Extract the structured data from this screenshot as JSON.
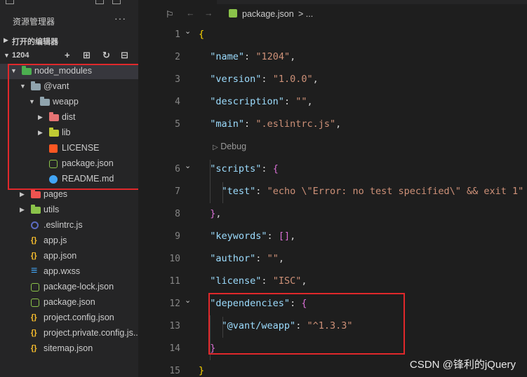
{
  "explorer": {
    "title": "资源管理器",
    "more": "···",
    "open_editors": "打开的编辑器",
    "project": "1204",
    "actions": [
      "+",
      "⊞",
      "↻",
      "⊟"
    ]
  },
  "tree": [
    {
      "name": "node_modules",
      "depth": 0,
      "chevron": "▼",
      "icon": "folder-icon",
      "color": "#4caf50"
    },
    {
      "name": "@vant",
      "depth": 1,
      "chevron": "▼",
      "icon": "folder-open-icon",
      "color": "#90a4ae"
    },
    {
      "name": "weapp",
      "depth": 2,
      "chevron": "▼",
      "icon": "folder-open-icon",
      "color": "#90a4ae"
    },
    {
      "name": "dist",
      "depth": 3,
      "chevron": "▶",
      "icon": "folder-icon",
      "color": "#e57373"
    },
    {
      "name": "lib",
      "depth": 3,
      "chevron": "▶",
      "icon": "folder-icon",
      "color": "#c0ca33"
    },
    {
      "name": "LICENSE",
      "depth": 3,
      "chevron": "",
      "icon": "license-icon",
      "color": "#ff5722"
    },
    {
      "name": "package.json",
      "depth": 3,
      "chevron": "",
      "icon": "nodejs-icon",
      "color": "#8bc34a"
    },
    {
      "name": "README.md",
      "depth": 3,
      "chevron": "",
      "icon": "info-icon",
      "color": "#42a5f5"
    },
    {
      "name": "pages",
      "depth": 1,
      "chevron": "▶",
      "icon": "folder-icon",
      "color": "#ef5350"
    },
    {
      "name": "utils",
      "depth": 1,
      "chevron": "▶",
      "icon": "folder-icon",
      "color": "#8bc34a"
    },
    {
      "name": ".eslintrc.js",
      "depth": 1,
      "chevron": "",
      "icon": "eslint-icon",
      "color": "#5c6bc0"
    },
    {
      "name": "app.js",
      "depth": 1,
      "chevron": "",
      "icon": "braces-icon",
      "color": "#fbc02d"
    },
    {
      "name": "app.json",
      "depth": 1,
      "chevron": "",
      "icon": "braces-icon",
      "color": "#fbc02d"
    },
    {
      "name": "app.wxss",
      "depth": 1,
      "chevron": "",
      "icon": "css-icon",
      "color": "#42a5f5"
    },
    {
      "name": "package-lock.json",
      "depth": 1,
      "chevron": "",
      "icon": "nodejs-icon",
      "color": "#8bc34a"
    },
    {
      "name": "package.json",
      "depth": 1,
      "chevron": "",
      "icon": "nodejs-icon",
      "color": "#8bc34a"
    },
    {
      "name": "project.config.json",
      "depth": 1,
      "chevron": "",
      "icon": "braces-icon",
      "color": "#fbc02d"
    },
    {
      "name": "project.private.config.js...",
      "depth": 1,
      "chevron": "",
      "icon": "braces-icon",
      "color": "#fbc02d"
    },
    {
      "name": "sitemap.json",
      "depth": 1,
      "chevron": "",
      "icon": "braces-icon",
      "color": "#fbc02d"
    }
  ],
  "editor": {
    "tab": "package.json",
    "breadcrumb_file": "package.json",
    "breadcrumb_tail": "> ...",
    "codelens": "Debug",
    "lines": [
      {
        "n": "1",
        "fold": "⌄",
        "parts": [
          {
            "t": "{",
            "c": "b1"
          }
        ]
      },
      {
        "n": "2",
        "fold": "",
        "parts": [
          {
            "t": "  ",
            "c": "p"
          },
          {
            "t": "\"name\"",
            "c": "k"
          },
          {
            "t": ": ",
            "c": "p"
          },
          {
            "t": "\"1204\"",
            "c": "s"
          },
          {
            "t": ",",
            "c": "p"
          }
        ]
      },
      {
        "n": "3",
        "fold": "",
        "parts": [
          {
            "t": "  ",
            "c": "p"
          },
          {
            "t": "\"version\"",
            "c": "k"
          },
          {
            "t": ": ",
            "c": "p"
          },
          {
            "t": "\"1.0.0\"",
            "c": "s"
          },
          {
            "t": ",",
            "c": "p"
          }
        ]
      },
      {
        "n": "4",
        "fold": "",
        "parts": [
          {
            "t": "  ",
            "c": "p"
          },
          {
            "t": "\"description\"",
            "c": "k"
          },
          {
            "t": ": ",
            "c": "p"
          },
          {
            "t": "\"\"",
            "c": "s"
          },
          {
            "t": ",",
            "c": "p"
          }
        ]
      },
      {
        "n": "5",
        "fold": "",
        "parts": [
          {
            "t": "  ",
            "c": "p"
          },
          {
            "t": "\"main\"",
            "c": "k"
          },
          {
            "t": ": ",
            "c": "p"
          },
          {
            "t": "\".eslintrc.js\"",
            "c": "s"
          },
          {
            "t": ",",
            "c": "p"
          }
        ]
      },
      {
        "n": "6",
        "fold": "⌄",
        "parts": [
          {
            "t": "  ",
            "c": "p"
          },
          {
            "t": "\"scripts\"",
            "c": "k"
          },
          {
            "t": ": ",
            "c": "p"
          },
          {
            "t": "{",
            "c": "b2"
          }
        ]
      },
      {
        "n": "7",
        "fold": "",
        "parts": [
          {
            "t": "    ",
            "c": "p"
          },
          {
            "t": "\"test\"",
            "c": "k"
          },
          {
            "t": ": ",
            "c": "p"
          },
          {
            "t": "\"echo \\\"Error: no test specified\\\" && exit 1\"",
            "c": "s"
          }
        ]
      },
      {
        "n": "8",
        "fold": "",
        "parts": [
          {
            "t": "  ",
            "c": "p"
          },
          {
            "t": "}",
            "c": "b2"
          },
          {
            "t": ",",
            "c": "p"
          }
        ]
      },
      {
        "n": "9",
        "fold": "",
        "parts": [
          {
            "t": "  ",
            "c": "p"
          },
          {
            "t": "\"keywords\"",
            "c": "k"
          },
          {
            "t": ": ",
            "c": "p"
          },
          {
            "t": "[]",
            "c": "b2"
          },
          {
            "t": ",",
            "c": "p"
          }
        ]
      },
      {
        "n": "10",
        "fold": "",
        "parts": [
          {
            "t": "  ",
            "c": "p"
          },
          {
            "t": "\"author\"",
            "c": "k"
          },
          {
            "t": ": ",
            "c": "p"
          },
          {
            "t": "\"\"",
            "c": "s"
          },
          {
            "t": ",",
            "c": "p"
          }
        ]
      },
      {
        "n": "11",
        "fold": "",
        "parts": [
          {
            "t": "  ",
            "c": "p"
          },
          {
            "t": "\"license\"",
            "c": "k"
          },
          {
            "t": ": ",
            "c": "p"
          },
          {
            "t": "\"ISC\"",
            "c": "s"
          },
          {
            "t": ",",
            "c": "p"
          }
        ]
      },
      {
        "n": "12",
        "fold": "⌄",
        "parts": [
          {
            "t": "  ",
            "c": "p"
          },
          {
            "t": "\"dependencies\"",
            "c": "k"
          },
          {
            "t": ": ",
            "c": "p"
          },
          {
            "t": "{",
            "c": "b2"
          }
        ]
      },
      {
        "n": "13",
        "fold": "",
        "parts": [
          {
            "t": "    ",
            "c": "p"
          },
          {
            "t": "\"@vant/weapp\"",
            "c": "k"
          },
          {
            "t": ": ",
            "c": "p"
          },
          {
            "t": "\"^1.3.3\"",
            "c": "s"
          }
        ]
      },
      {
        "n": "14",
        "fold": "",
        "parts": [
          {
            "t": "  ",
            "c": "p"
          },
          {
            "t": "}",
            "c": "b2"
          }
        ]
      },
      {
        "n": "15",
        "fold": "",
        "parts": [
          {
            "t": "}",
            "c": "b1"
          }
        ]
      }
    ]
  },
  "watermark": "CSDN @锋利的jQuery"
}
